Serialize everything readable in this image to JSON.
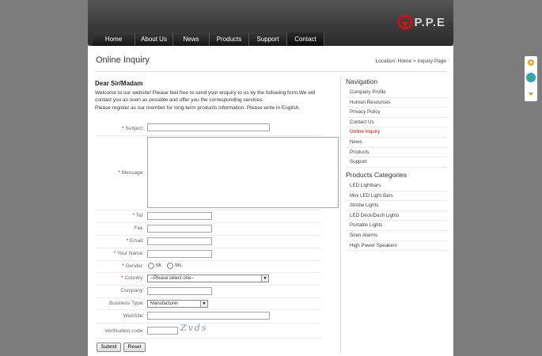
{
  "header": {
    "logo_text": "P.P.E",
    "nav": [
      {
        "label": "Home"
      },
      {
        "label": "About Us"
      },
      {
        "label": "News"
      },
      {
        "label": "Products"
      },
      {
        "label": "Support"
      },
      {
        "label": "Contact"
      }
    ]
  },
  "page": {
    "title": "Online Inquiry",
    "breadcrumb_prefix": "Location:",
    "breadcrumb_home": "Home",
    "breadcrumb_sep": ">",
    "breadcrumb_current": "Inquiry Page"
  },
  "main": {
    "greeting": "Dear Sir/Madam",
    "intro1": "Welcome to our website! Please feel free to send your enquiry to us by the following form,We will contact you as soon as possible and offer you the corresponding services.",
    "intro2": "Please register as our member for long-term products information. Please write in English."
  },
  "form": {
    "required_mark": "*",
    "subject": "Subject:",
    "message": "Message:",
    "tel": "Tel:",
    "fax": "Fax:",
    "email": "Email:",
    "your_name": "Your Name:",
    "gender": "Gender:",
    "gender_mr": "Mr.",
    "gender_ms": "Ms.",
    "country": "Country:",
    "country_value": "--Please select one--",
    "company": "Company:",
    "business_type": "Business Type:",
    "business_type_value": "Manufacturer",
    "website": "WebSite:",
    "verification": "Verification code:",
    "captcha_text": "Zvds",
    "submit": "Submit",
    "reset": "Reset"
  },
  "sidebar": {
    "nav_title": "Navigation",
    "nav_items": [
      {
        "label": "Company Profile"
      },
      {
        "label": "Human Resources"
      },
      {
        "label": "Privacy Policy"
      },
      {
        "label": "Contact Us"
      },
      {
        "label": "Online Inquiry"
      },
      {
        "label": "News"
      },
      {
        "label": "Products"
      },
      {
        "label": "Support"
      }
    ],
    "cat_title": "Products Categories",
    "cat_items": [
      {
        "label": "LED Lightbars"
      },
      {
        "label": "Mini LED Light Bars"
      },
      {
        "label": "Strobe Lights"
      },
      {
        "label": "LED Deck/Dash Lights"
      },
      {
        "label": "Portable Lights"
      },
      {
        "label": "Siren Alarms"
      },
      {
        "label": "High Power Speakers"
      }
    ]
  },
  "colors": {
    "accent_red": "#e00000",
    "background": "#7c7c7c",
    "nav_dark": "#1a1a1a"
  },
  "icons": [
    "logo-mark-icon",
    "chevron-down-icon",
    "chat-icon",
    "globe-icon",
    "scroll-down-icon"
  ]
}
